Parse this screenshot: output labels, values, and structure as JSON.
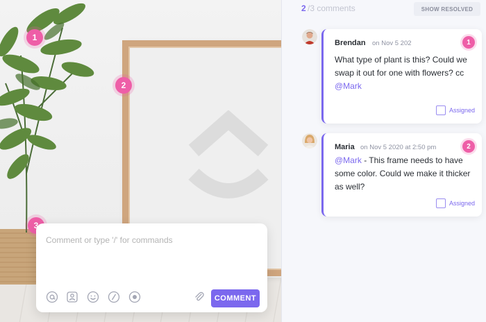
{
  "image": {
    "markers": [
      "1",
      "2",
      "3"
    ]
  },
  "composer": {
    "placeholder": "Comment or type '/' for commands",
    "submit_label": "COMMENT",
    "tools": [
      "mention-icon",
      "assign-icon",
      "emoji-icon",
      "slash-command-icon",
      "record-icon",
      "attachment-icon"
    ]
  },
  "panel": {
    "count_current": "2",
    "count_rest": "/3 comments",
    "show_resolved_label": "SHOW RESOLVED",
    "comments": [
      {
        "author": "Brendan",
        "time": "on Nov 5 202",
        "badge": "1",
        "text_before": "What type of plant is this? Could we swap it out for one with flowers? cc ",
        "mention": "@Mark",
        "text_after": "",
        "assigned_label": "Assigned"
      },
      {
        "author": "Maria",
        "time": "on Nov 5 2020 at 2:50 pm",
        "badge": "2",
        "text_before": "",
        "mention": "@Mark",
        "text_after": " - This frame needs to have some color. Could we make it thicker as well?",
        "assigned_label": "Assigned"
      }
    ]
  },
  "colors": {
    "accent": "#7b68ee",
    "marker": "#ee5ea7"
  }
}
